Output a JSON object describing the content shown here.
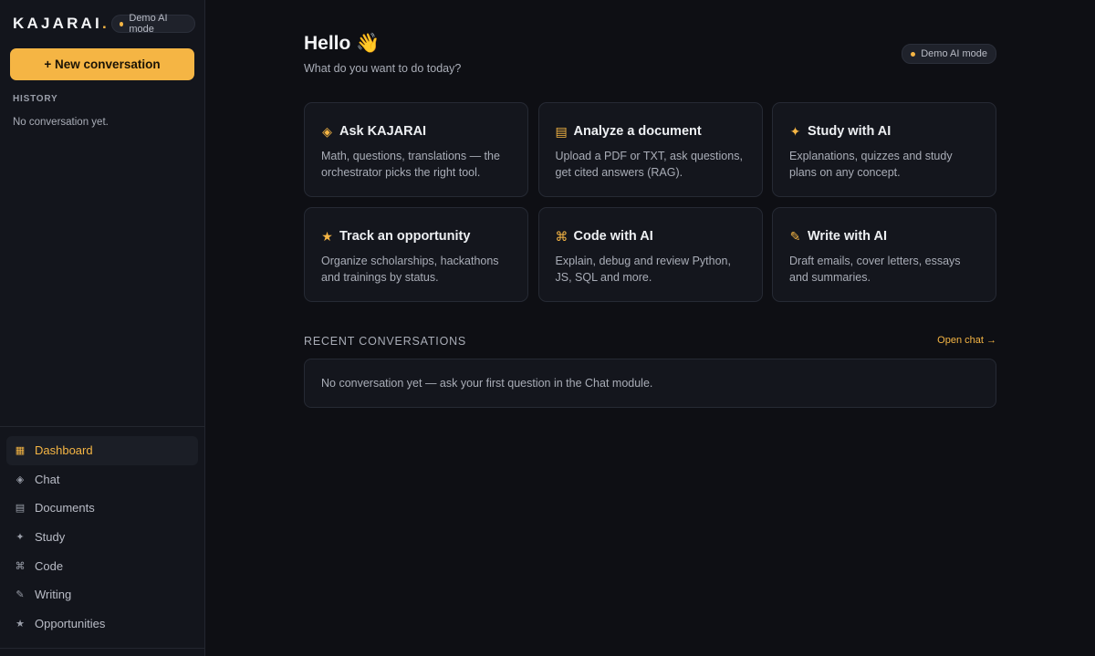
{
  "sidebar": {
    "logo": "KAJARAI",
    "logo_dot": ".",
    "badge": "Demo AI mode",
    "new_button": "+ New conversation",
    "history_title": "HISTORY",
    "history_empty": "No conversation yet.",
    "nav": [
      {
        "icon": "▦",
        "icon_name": "dashboard-icon",
        "label": "Dashboard",
        "active": true
      },
      {
        "icon": "◈",
        "icon_name": "chat-icon",
        "label": "Chat"
      },
      {
        "icon": "▤",
        "icon_name": "documents-icon",
        "label": "Documents"
      },
      {
        "icon": "✦",
        "icon_name": "sparkle-icon",
        "label": "Study"
      },
      {
        "icon": "⌘",
        "icon_name": "command-icon",
        "label": "Code"
      },
      {
        "icon": "✎",
        "icon_name": "pencil-icon",
        "label": "Writing"
      },
      {
        "icon": "★",
        "icon_name": "star-icon",
        "label": "Opportunities"
      }
    ]
  },
  "main": {
    "greeting": "Hello 👋",
    "subtitle": "What do you want to do today?",
    "badge": "Demo AI mode",
    "cards": [
      {
        "icon": "◈",
        "icon_name": "diamond-icon",
        "title": "Ask KAJARAI",
        "desc": "Math, questions, translations — the orchestrator picks the right tool."
      },
      {
        "icon": "▤",
        "icon_name": "document-icon",
        "title": "Analyze a document",
        "desc": "Upload a PDF or TXT, ask questions, get cited answers (RAG)."
      },
      {
        "icon": "✦",
        "icon_name": "sparkle-icon",
        "title": "Study with AI",
        "desc": "Explanations, quizzes and study plans on any concept."
      },
      {
        "icon": "★",
        "icon_name": "star-icon",
        "title": "Track an opportunity",
        "desc": "Organize scholarships, hackathons and trainings by status."
      },
      {
        "icon": "⌘",
        "icon_name": "command-icon",
        "title": "Code with AI",
        "desc": "Explain, debug and review Python, JS, SQL and more."
      },
      {
        "icon": "✎",
        "icon_name": "pencil-icon",
        "title": "Write with AI",
        "desc": "Draft emails, cover letters, essays and summaries."
      }
    ],
    "recent_title": "RECENT CONVERSATIONS",
    "open_chat": "Open chat →",
    "recent_empty": "No conversation yet — ask your first question in the Chat module."
  },
  "colors": {
    "accent": "#f5b544",
    "background": "#0e0f14",
    "sidebar": "#13151c",
    "card": "#14161d"
  }
}
